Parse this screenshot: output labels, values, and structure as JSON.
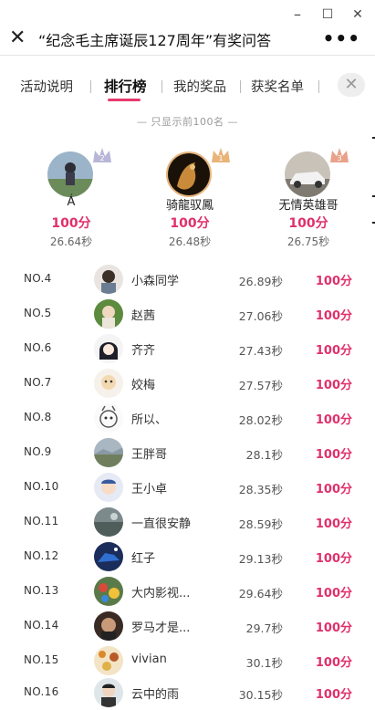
{
  "window": {
    "minimize_icon": "minimize-icon",
    "maximize_icon": "maximize-icon",
    "close_icon": "close-icon",
    "minimize_glyph": "–",
    "maximize_glyph": "☐",
    "close_glyph": "✕"
  },
  "header": {
    "close_glyph": "✕",
    "title": "“纪念毛主席诞辰127周年”有奖问答",
    "more_glyph": "•••"
  },
  "tabs": [
    {
      "label": "活动说明"
    },
    {
      "label": "排行榜"
    },
    {
      "label": "我的奖品"
    },
    {
      "label": "获奖名单"
    }
  ],
  "tabs_close_glyph": "✕",
  "top_note": "— 只显示前100名 —",
  "podium": [
    {
      "rank": "2",
      "name": "Á",
      "score": "100分",
      "time": "26.64秒"
    },
    {
      "rank": "1",
      "name": "骑龍驭鳳",
      "score": "100分",
      "time": "26.48秒"
    },
    {
      "rank": "3",
      "name": "无情英雄哥",
      "score": "100分",
      "time": "26.75秒"
    }
  ],
  "ranking": [
    {
      "no": "NO.4",
      "name": "小森同学",
      "time": "26.89秒",
      "score": "100分"
    },
    {
      "no": "NO.5",
      "name": "赵茜",
      "time": "27.06秒",
      "score": "100分"
    },
    {
      "no": "NO.6",
      "name": "齐齐",
      "time": "27.43秒",
      "score": "100分"
    },
    {
      "no": "NO.7",
      "name": "姣梅",
      "time": "27.57秒",
      "score": "100分"
    },
    {
      "no": "NO.8",
      "name": "所以、",
      "time": "28.02秒",
      "score": "100分"
    },
    {
      "no": "NO.9",
      "name": "王胖哥",
      "time": "28.1秒",
      "score": "100分"
    },
    {
      "no": "NO.10",
      "name": "王小卓",
      "time": "28.35秒",
      "score": "100分"
    },
    {
      "no": "NO.11",
      "name": "一直很安静",
      "time": "28.59秒",
      "score": "100分"
    },
    {
      "no": "NO.12",
      "name": "红子",
      "time": "29.13秒",
      "score": "100分"
    },
    {
      "no": "NO.13",
      "name": "大内影视...",
      "time": "29.64秒",
      "score": "100分"
    },
    {
      "no": "NO.14",
      "name": "罗马才是...",
      "time": "29.7秒",
      "score": "100分"
    },
    {
      "no": "NO.15",
      "name": "vivian",
      "time": "30.1秒",
      "score": "100分"
    },
    {
      "no": "NO.16",
      "name": "云中的雨",
      "time": "30.15秒",
      "score": "100分"
    }
  ],
  "colors": {
    "accent": "#e0306b",
    "tab_underline": "#e63a6e",
    "gold": "#e8b47a",
    "silver": "#b8b7d8",
    "bronze": "#e8a28a"
  }
}
